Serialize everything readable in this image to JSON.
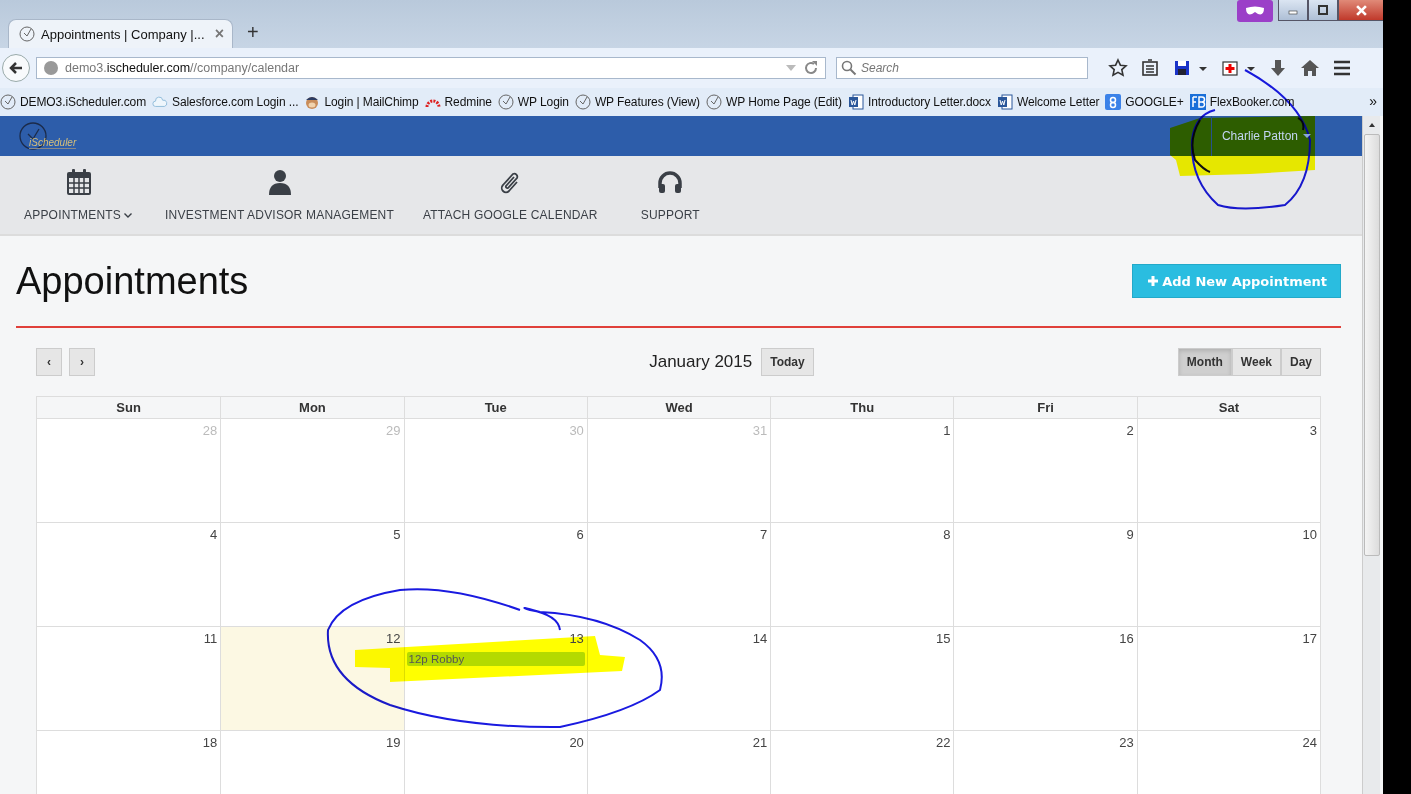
{
  "browser": {
    "tab": {
      "title": "Appointments | Company |...",
      "close": "×"
    },
    "new_tab": "+",
    "address": "demo3.**ischeduler.com**//company/calendar",
    "search": {
      "placeholder": "Search"
    },
    "bookmarks": [
      "DEMO3.iScheduler.com",
      "Salesforce.com Login ...",
      "Login | MailChimp",
      "Redmine",
      "WP Login",
      "WP Features (View)",
      "WP Home Page (Edit)",
      "Introductory Letter.docx",
      "Welcome Letter",
      "GOOGLE+",
      "FlexBooker.com"
    ],
    "more": "»"
  },
  "app": {
    "logo": "iScheduler",
    "user": "Charlie Patton",
    "nav": [
      {
        "label": "APPOINTMENTS",
        "dropdown": true
      },
      {
        "label": "INVESTMENT ADVISOR MANAGEMENT",
        "dropdown": false
      },
      {
        "label": "ATTACH GOOGLE CALENDAR",
        "dropdown": false
      },
      {
        "label": "SUPPORT",
        "dropdown": false
      }
    ],
    "title": "Appointments",
    "add_button": "Add New Appointment",
    "calendar": {
      "prev": "‹",
      "next": "›",
      "title": "January 2015",
      "today": "Today",
      "views": [
        {
          "label": "Month",
          "selected": true
        },
        {
          "label": "Week",
          "selected": false
        },
        {
          "label": "Day",
          "selected": false
        }
      ],
      "weekdays": [
        "Sun",
        "Mon",
        "Tue",
        "Wed",
        "Thu",
        "Fri",
        "Sat"
      ],
      "weeks": [
        [
          {
            "day": "28",
            "other_month": true,
            "today": false
          },
          {
            "day": "29",
            "other_month": true,
            "today": false
          },
          {
            "day": "30",
            "other_month": true,
            "today": false
          },
          {
            "day": "31",
            "other_month": true,
            "today": false
          },
          {
            "day": "1",
            "other_month": false,
            "today": false
          },
          {
            "day": "2",
            "other_month": false,
            "today": false
          },
          {
            "day": "3",
            "other_month": false,
            "today": false
          }
        ],
        [
          {
            "day": "4",
            "other_month": false,
            "today": false
          },
          {
            "day": "5",
            "other_month": false,
            "today": false
          },
          {
            "day": "6",
            "other_month": false,
            "today": false
          },
          {
            "day": "7",
            "other_month": false,
            "today": false
          },
          {
            "day": "8",
            "other_month": false,
            "today": false
          },
          {
            "day": "9",
            "other_month": false,
            "today": false
          },
          {
            "day": "10",
            "other_month": false,
            "today": false
          }
        ],
        [
          {
            "day": "11",
            "other_month": false,
            "today": false
          },
          {
            "day": "12",
            "other_month": false,
            "today": true
          },
          {
            "day": "13",
            "other_month": false,
            "today": false,
            "events": [
              {
                "time": "12p",
                "title": "Robby"
              }
            ]
          },
          {
            "day": "14",
            "other_month": false,
            "today": false
          },
          {
            "day": "15",
            "other_month": false,
            "today": false
          },
          {
            "day": "16",
            "other_month": false,
            "today": false
          },
          {
            "day": "17",
            "other_month": false,
            "today": false
          }
        ],
        [
          {
            "day": "18",
            "other_month": false,
            "today": false
          },
          {
            "day": "19",
            "other_month": false,
            "today": false
          },
          {
            "day": "20",
            "other_month": false,
            "today": false
          },
          {
            "day": "21",
            "other_month": false,
            "today": false
          },
          {
            "day": "22",
            "other_month": false,
            "today": false
          },
          {
            "day": "23",
            "other_month": false,
            "today": false
          },
          {
            "day": "24",
            "other_month": false,
            "today": false
          }
        ]
      ]
    }
  }
}
